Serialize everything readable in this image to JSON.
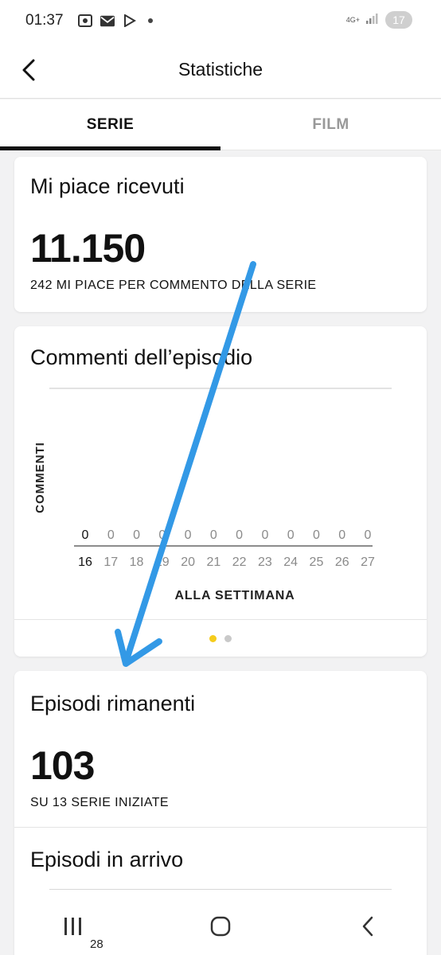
{
  "status_bar": {
    "time": "01:37",
    "network": "4G+",
    "battery": "17"
  },
  "header": {
    "title": "Statistiche"
  },
  "tabs": [
    {
      "label": "SERIE",
      "active": true
    },
    {
      "label": "FILM",
      "active": false
    }
  ],
  "likes_card": {
    "title": "Mi piace ricevuti",
    "value": "11.150",
    "caption": "242 MI PIACE PER COMMENTO DELLA SERIE"
  },
  "comments_card": {
    "title": "Commenti dell’episodio",
    "pagination": {
      "pages": 2,
      "current": 1
    }
  },
  "chart_data": {
    "type": "bar",
    "title": "Commenti dell’episodio",
    "ylabel": "COMMENTI",
    "xlabel": "ALLA SETTIMANA",
    "categories": [
      "16",
      "17",
      "18",
      "19",
      "20",
      "21",
      "22",
      "23",
      "24",
      "25",
      "26",
      "27"
    ],
    "values": [
      0,
      0,
      0,
      0,
      0,
      0,
      0,
      0,
      0,
      0,
      0,
      0
    ],
    "highlighted_category": "16",
    "grid": true
  },
  "remaining_card": {
    "title": "Episodi rimanenti",
    "value": "103",
    "caption": "SU 13 SERIE INIZIATE",
    "next_title": "Episodi in arrivo"
  },
  "navbar": {
    "sub_label": "28"
  },
  "colors": {
    "accent_dot": "#f5cc1c",
    "annotation_arrow": "#3399e6"
  }
}
